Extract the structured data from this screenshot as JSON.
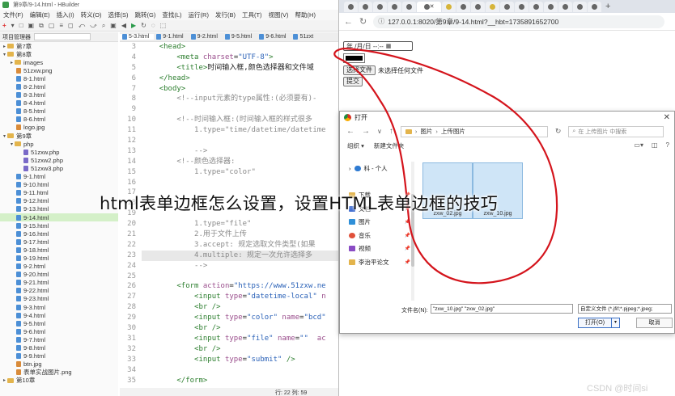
{
  "ide": {
    "title": "第9章/9-14.html - HBuilder",
    "menu": [
      "文件(F)",
      "编辑(E)",
      "插入(I)",
      "转义(O)",
      "选择(S)",
      "跳转(G)",
      "查找(L)",
      "运行(R)",
      "发行(B)",
      "工具(T)",
      "视图(V)",
      "帮助(H)"
    ],
    "toolbar": [
      "+",
      "▾",
      "□",
      "▣",
      "⧉",
      "▢",
      "≡",
      "◻",
      "⤺",
      "⤻",
      "⌕",
      "▣",
      "◀",
      "▶",
      "↻",
      "◌",
      "⬚"
    ],
    "project_header": "项目管理器",
    "tabs": [
      {
        "label": "5-3.html"
      },
      {
        "label": "9-1.html"
      },
      {
        "label": "9-2.html"
      },
      {
        "label": "9-5.html"
      },
      {
        "label": "9-6.html"
      },
      {
        "label": "51zxt"
      }
    ],
    "tree": [
      {
        "label": "第7章",
        "type": "folder",
        "indent": 0,
        "open": false
      },
      {
        "label": "第8章",
        "type": "folder",
        "indent": 0,
        "open": true
      },
      {
        "label": "images",
        "type": "folder",
        "indent": 1,
        "open": false
      },
      {
        "label": "51zxw.png",
        "type": "img",
        "indent": 2
      },
      {
        "label": "8-1.html",
        "type": "html",
        "indent": 2
      },
      {
        "label": "8-2.html",
        "type": "html",
        "indent": 2
      },
      {
        "label": "8-3.html",
        "type": "html",
        "indent": 2
      },
      {
        "label": "8-4.html",
        "type": "html",
        "indent": 2
      },
      {
        "label": "8-5.html",
        "type": "html",
        "indent": 2
      },
      {
        "label": "8-6.html",
        "type": "html",
        "indent": 2
      },
      {
        "label": "logo.jpg",
        "type": "img",
        "indent": 2
      },
      {
        "label": "第9章",
        "type": "folder",
        "indent": 0,
        "open": true
      },
      {
        "label": "php",
        "type": "folder",
        "indent": 1,
        "open": true
      },
      {
        "label": "51zxw.php",
        "type": "php",
        "indent": 3
      },
      {
        "label": "51zxw2.php",
        "type": "php",
        "indent": 3
      },
      {
        "label": "51zxw3.php",
        "type": "php",
        "indent": 3
      },
      {
        "label": "9-1.html",
        "type": "html",
        "indent": 2
      },
      {
        "label": "9-10.html",
        "type": "html",
        "indent": 2
      },
      {
        "label": "9-11.html",
        "type": "html",
        "indent": 2
      },
      {
        "label": "9-12.html",
        "type": "html",
        "indent": 2
      },
      {
        "label": "9-13.html",
        "type": "html",
        "indent": 2
      },
      {
        "label": "9-14.html",
        "type": "html",
        "indent": 2,
        "selected": true
      },
      {
        "label": "9-15.html",
        "type": "html",
        "indent": 2
      },
      {
        "label": "9-16.html",
        "type": "html",
        "indent": 2
      },
      {
        "label": "9-17.html",
        "type": "html",
        "indent": 2
      },
      {
        "label": "9-18.html",
        "type": "html",
        "indent": 2
      },
      {
        "label": "9-19.html",
        "type": "html",
        "indent": 2
      },
      {
        "label": "9-2.html",
        "type": "html",
        "indent": 2
      },
      {
        "label": "9-20.html",
        "type": "html",
        "indent": 2
      },
      {
        "label": "9-21.html",
        "type": "html",
        "indent": 2
      },
      {
        "label": "9-22.html",
        "type": "html",
        "indent": 2
      },
      {
        "label": "9-23.html",
        "type": "html",
        "indent": 2
      },
      {
        "label": "9-3.html",
        "type": "html",
        "indent": 2
      },
      {
        "label": "9-4.html",
        "type": "html",
        "indent": 2
      },
      {
        "label": "9-5.html",
        "type": "html",
        "indent": 2
      },
      {
        "label": "9-6.html",
        "type": "html",
        "indent": 2
      },
      {
        "label": "9-7.html",
        "type": "html",
        "indent": 2
      },
      {
        "label": "9-8.html",
        "type": "html",
        "indent": 2
      },
      {
        "label": "9-9.html",
        "type": "html",
        "indent": 2
      },
      {
        "label": "btn.jpg",
        "type": "img",
        "indent": 2
      },
      {
        "label": "表单实战图片.png",
        "type": "img",
        "indent": 2
      },
      {
        "label": "第10章",
        "type": "folder",
        "indent": 0,
        "open": false
      }
    ],
    "lines": [
      {
        "n": "3",
        "cls": "",
        "parts": [
          [
            "t",
            "    "
          ],
          [
            "tag",
            "<head>"
          ]
        ]
      },
      {
        "n": "4",
        "cls": "",
        "parts": [
          [
            "t",
            "        "
          ],
          [
            "tag",
            "<meta "
          ],
          [
            "attr",
            "charset"
          ],
          [
            "t",
            "="
          ],
          [
            "str",
            "\"UTF-8\""
          ],
          [
            "tag",
            ">"
          ]
        ]
      },
      {
        "n": "5",
        "cls": "",
        "parts": [
          [
            "t",
            "        "
          ],
          [
            "tag",
            "<title>"
          ],
          [
            "t",
            "时间输入框,颜色选择器和文件域"
          ]
        ]
      },
      {
        "n": "6",
        "cls": "",
        "parts": [
          [
            "t",
            "    "
          ],
          [
            "tag",
            "</head>"
          ]
        ]
      },
      {
        "n": "7",
        "cls": "",
        "parts": [
          [
            "t",
            "    "
          ],
          [
            "tag",
            "<body>"
          ]
        ]
      },
      {
        "n": "8",
        "cls": "",
        "parts": [
          [
            "t",
            "        "
          ],
          [
            "com",
            "<!--input元素的type属性:(必须要有)-"
          ]
        ]
      },
      {
        "n": "9",
        "cls": "",
        "parts": [
          [
            "t",
            ""
          ]
        ]
      },
      {
        "n": "10",
        "cls": "",
        "parts": [
          [
            "t",
            "        "
          ],
          [
            "com",
            "<!--时间输入框:(时间输入框的样式很多"
          ]
        ]
      },
      {
        "n": "11",
        "cls": "",
        "parts": [
          [
            "t",
            "            "
          ],
          [
            "com",
            "1.type=\"time/datetime/datetime"
          ]
        ]
      },
      {
        "n": "12",
        "cls": "",
        "parts": [
          [
            "t",
            ""
          ]
        ]
      },
      {
        "n": "13",
        "cls": "",
        "parts": [
          [
            "t",
            "            "
          ],
          [
            "com",
            "-->"
          ]
        ]
      },
      {
        "n": "14",
        "cls": "",
        "parts": [
          [
            "t",
            "        "
          ],
          [
            "com",
            "<!--颜色选择器:"
          ]
        ]
      },
      {
        "n": "15",
        "cls": "",
        "parts": [
          [
            "t",
            "            "
          ],
          [
            "com",
            "1.type=\"color\""
          ]
        ]
      },
      {
        "n": "16",
        "cls": "",
        "parts": [
          [
            "t",
            ""
          ]
        ]
      },
      {
        "n": "17",
        "cls": "",
        "parts": [
          [
            "t",
            ""
          ]
        ]
      },
      {
        "n": "18",
        "cls": "",
        "parts": [
          [
            "t",
            ""
          ]
        ]
      },
      {
        "n": "19",
        "cls": "",
        "parts": [
          [
            "t",
            ""
          ]
        ]
      },
      {
        "n": "20",
        "cls": "",
        "parts": [
          [
            "t",
            "            "
          ],
          [
            "com",
            "1.type=\"file\""
          ]
        ]
      },
      {
        "n": "21",
        "cls": "",
        "parts": [
          [
            "t",
            "            "
          ],
          [
            "com",
            "2.用于文件上传"
          ]
        ]
      },
      {
        "n": "22",
        "cls": "",
        "parts": [
          [
            "t",
            "            "
          ],
          [
            "com",
            "3.accept: 规定选取文件类型(如果"
          ]
        ]
      },
      {
        "n": "23",
        "cls": "sel",
        "parts": [
          [
            "t",
            "            "
          ],
          [
            "com",
            "4.multiple: 规定一次允许选择多"
          ]
        ]
      },
      {
        "n": "24",
        "cls": "",
        "parts": [
          [
            "t",
            "            "
          ],
          [
            "com",
            "-->"
          ]
        ]
      },
      {
        "n": "25",
        "cls": "",
        "parts": [
          [
            "t",
            ""
          ]
        ]
      },
      {
        "n": "26",
        "cls": "",
        "parts": [
          [
            "t",
            "        "
          ],
          [
            "tag",
            "<form "
          ],
          [
            "attr",
            "action"
          ],
          [
            "t",
            "="
          ],
          [
            "str",
            "\"https://www.51zxw.ne"
          ]
        ]
      },
      {
        "n": "27",
        "cls": "",
        "parts": [
          [
            "t",
            "            "
          ],
          [
            "tag",
            "<input "
          ],
          [
            "attr",
            "type"
          ],
          [
            "t",
            "="
          ],
          [
            "str",
            "\"datetime-local\""
          ],
          [
            "attr",
            " n"
          ]
        ]
      },
      {
        "n": "28",
        "cls": "",
        "parts": [
          [
            "t",
            "            "
          ],
          [
            "tag",
            "<br />"
          ]
        ]
      },
      {
        "n": "29",
        "cls": "",
        "parts": [
          [
            "t",
            "            "
          ],
          [
            "tag",
            "<input "
          ],
          [
            "attr",
            "type"
          ],
          [
            "t",
            "="
          ],
          [
            "str",
            "\"color\""
          ],
          [
            "attr",
            " name"
          ],
          [
            "t",
            "="
          ],
          [
            "str",
            "\"bcd\""
          ]
        ]
      },
      {
        "n": "30",
        "cls": "",
        "parts": [
          [
            "t",
            "            "
          ],
          [
            "tag",
            "<br />"
          ]
        ]
      },
      {
        "n": "31",
        "cls": "",
        "parts": [
          [
            "t",
            "            "
          ],
          [
            "tag",
            "<input "
          ],
          [
            "attr",
            "type"
          ],
          [
            "t",
            "="
          ],
          [
            "str",
            "\"file\""
          ],
          [
            "attr",
            " name"
          ],
          [
            "t",
            "="
          ],
          [
            "str",
            "\"\""
          ],
          [
            "attr",
            "  ac"
          ]
        ]
      },
      {
        "n": "32",
        "cls": "",
        "parts": [
          [
            "t",
            "            "
          ],
          [
            "tag",
            "<br />"
          ]
        ]
      },
      {
        "n": "33",
        "cls": "",
        "parts": [
          [
            "t",
            "            "
          ],
          [
            "tag",
            "<input "
          ],
          [
            "attr",
            "type"
          ],
          [
            "t",
            "="
          ],
          [
            "str",
            "\"submit\""
          ],
          [
            "tag",
            " />"
          ]
        ]
      },
      {
        "n": "34",
        "cls": "",
        "parts": [
          [
            "t",
            ""
          ]
        ]
      },
      {
        "n": "35",
        "cls": "",
        "parts": [
          [
            "t",
            "        "
          ],
          [
            "tag",
            "</form>"
          ]
        ]
      }
    ],
    "status": "行: 22 列: 59"
  },
  "browser": {
    "tab_count": 17,
    "url": "127.0.0.1:8020/第9章/9-14.html?__hbt=1735891652700",
    "datetime_placeholder": "年 /月/日 --:--",
    "color_value": "#000000",
    "file_button": "选择文件",
    "file_status": "未选择任何文件",
    "submit_label": "提交"
  },
  "dialog": {
    "title": "打开",
    "path": [
      "图片",
      "上传图片"
    ],
    "search_placeholder": "在 上传图片 中搜索",
    "organize": "组织 ▾",
    "new_folder": "新建文件夹",
    "sidebar": [
      {
        "label": "科 - 个人",
        "icon": "cloud"
      },
      {
        "label": "下载",
        "icon": "fold"
      },
      {
        "label": "文档",
        "icon": "doc"
      },
      {
        "label": "图片",
        "icon": "pic"
      },
      {
        "label": "音乐",
        "icon": "mus"
      },
      {
        "label": "视频",
        "icon": "vid"
      },
      {
        "label": "李治平论文",
        "icon": "fold"
      }
    ],
    "files": [
      "zxw_02.jpg",
      "zxw_10.jpg"
    ],
    "filename_label": "文件名(N):",
    "filename_value": "\"zxw_10.jpg\" \"zxw_02.jpg\"",
    "filetype_value": "自定义文件 (*.jfif;*.pjpeg;*.jpeg;",
    "open_label": "打开(O)",
    "cancel_label": "取消"
  },
  "overlay": {
    "article_title": "html表单边框怎么设置，设置HTML表单边框的技巧",
    "watermark": "CSDN @时间si",
    "annotation_color": "#d4141c"
  }
}
